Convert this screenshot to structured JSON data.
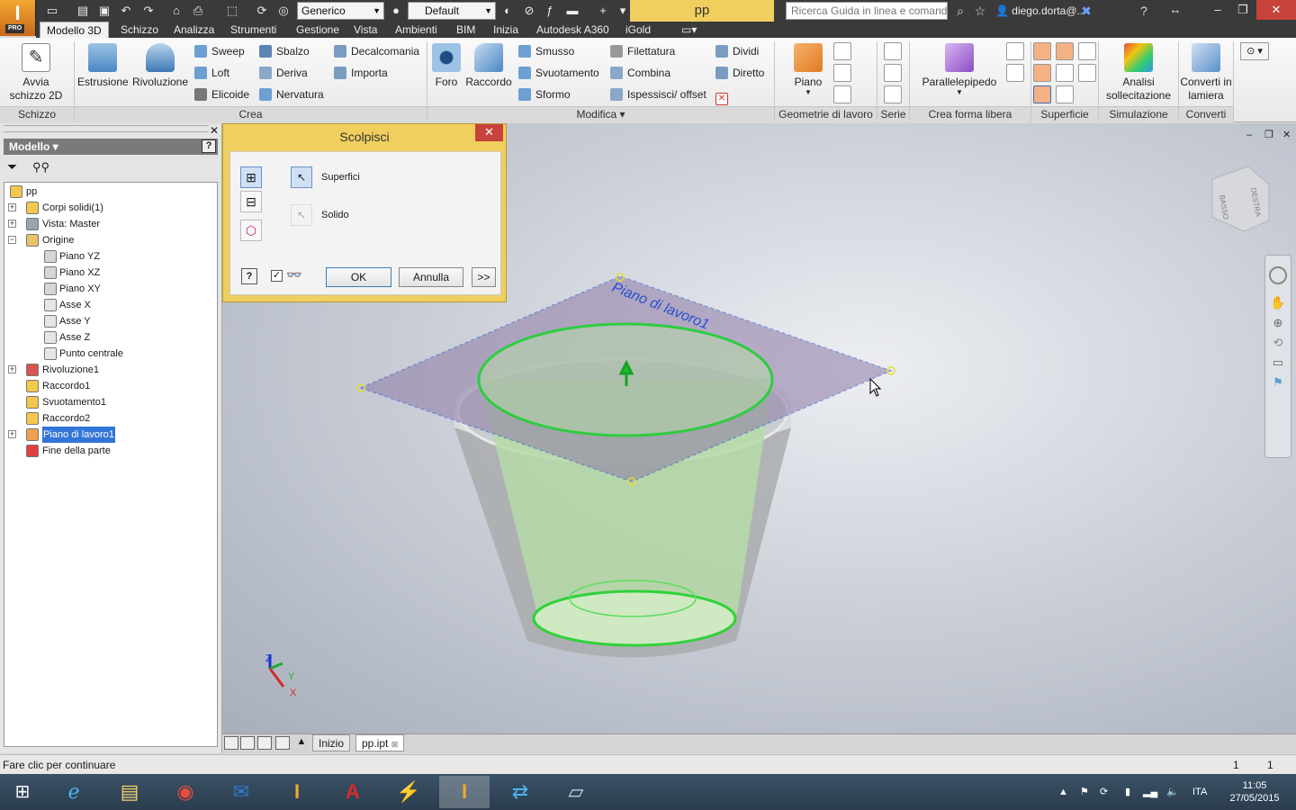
{
  "app": {
    "badge": "PRO",
    "letter": "I"
  },
  "titlebar": {
    "material_combo": "Generico",
    "appearance_combo": "Default",
    "doc_title": "pp",
    "search_placeholder": "Ricerca Guida in linea e comand",
    "user": "diego.dorta@..."
  },
  "menu_tabs": [
    "Modello 3D",
    "Schizzo",
    "Analizza",
    "Strumenti",
    "Gestione",
    "Vista",
    "Ambienti",
    "BIM",
    "Inizia",
    "Autodesk A360",
    "iGold"
  ],
  "ribbon": {
    "schizzo": {
      "avvia": "Avvia schizzo 2D",
      "footer": "Schizzo"
    },
    "crea": {
      "estrusione": "Estrusione",
      "rivoluzione": "Rivoluzione",
      "sweep": "Sweep",
      "loft": "Loft",
      "elicoide": "Elicoide",
      "sbalzo": "Sbalzo",
      "deriva": "Deriva",
      "nervatura": "Nervatura",
      "decalcomania": "Decalcomania",
      "importa": "Importa",
      "footer": "Crea"
    },
    "modifica": {
      "foro": "Foro",
      "raccordo": "Raccordo",
      "smusso": "Smusso",
      "svuotamento": "Svuotamento",
      "sformo": "Sformo",
      "filettatura": "Filettatura",
      "combina": "Combina",
      "ispessisci": "Ispessisci/ offset",
      "dividi": "Dividi",
      "diretto": "Diretto",
      "footer": "Modifica"
    },
    "geometrie": {
      "piano": "Piano",
      "footer": "Geometrie di lavoro"
    },
    "serie": {
      "footer": "Serie"
    },
    "forma_libera": {
      "parallelepipedo": "Parallelepipedo",
      "footer": "Crea forma libera"
    },
    "superficie": {
      "footer": "Superficie"
    },
    "simulazione": {
      "analisi": "Analisi sollecitazione",
      "footer": "Simulazione"
    },
    "converti": {
      "lamiera": "Converti in lamiera",
      "footer": "Converti"
    }
  },
  "browser": {
    "title": "Modello",
    "tree": [
      {
        "label": "pp",
        "level": 0,
        "expander": false,
        "icon": "part-icon",
        "color": "#f2c94c"
      },
      {
        "label": "Corpi solidi(1)",
        "level": 1,
        "expander": true,
        "icon": "solid-bodies-icon",
        "color": "#f2c94c"
      },
      {
        "label": "Vista: Master",
        "level": 1,
        "expander": true,
        "icon": "view-rep-icon",
        "color": "#9aa4b0"
      },
      {
        "label": "Origine",
        "level": 1,
        "expander": "open",
        "icon": "folder-icon",
        "color": "#e8c36a"
      },
      {
        "label": "Piano YZ",
        "level": 2,
        "expander": false,
        "icon": "plane-icon",
        "color": "#d6d6d6"
      },
      {
        "label": "Piano XZ",
        "level": 2,
        "expander": false,
        "icon": "plane-icon",
        "color": "#d6d6d6"
      },
      {
        "label": "Piano XY",
        "level": 2,
        "expander": false,
        "icon": "plane-icon",
        "color": "#d6d6d6"
      },
      {
        "label": "Asse X",
        "level": 2,
        "expander": false,
        "icon": "axis-icon",
        "color": "#e6e6e6"
      },
      {
        "label": "Asse Y",
        "level": 2,
        "expander": false,
        "icon": "axis-icon",
        "color": "#e6e6e6"
      },
      {
        "label": "Asse Z",
        "level": 2,
        "expander": false,
        "icon": "axis-icon",
        "color": "#e6e6e6"
      },
      {
        "label": "Punto centrale",
        "level": 2,
        "expander": false,
        "icon": "point-icon",
        "color": "#e6e6e6"
      },
      {
        "label": "Rivoluzione1",
        "level": 1,
        "expander": true,
        "icon": "revolve-icon",
        "color": "#d9534f"
      },
      {
        "label": "Raccordo1",
        "level": 1,
        "expander": false,
        "icon": "fillet-icon",
        "color": "#f2c94c"
      },
      {
        "label": "Svuotamento1",
        "level": 1,
        "expander": false,
        "icon": "shell-icon",
        "color": "#f2c94c"
      },
      {
        "label": "Raccordo2",
        "level": 1,
        "expander": false,
        "icon": "fillet-icon",
        "color": "#f2c94c"
      },
      {
        "label": "Piano di lavoro1",
        "level": 1,
        "expander": true,
        "icon": "workplane-icon",
        "color": "#f0a050",
        "selected": true
      },
      {
        "label": "Fine della parte",
        "level": 1,
        "expander": false,
        "icon": "end-of-part-icon",
        "color": "#e04040"
      }
    ]
  },
  "dialog": {
    "title": "Scolpisci",
    "option_surfaces": "Superfici",
    "option_solid": "Solido",
    "ok": "OK",
    "cancel": "Annulla",
    "more": ">>"
  },
  "viewport": {
    "workplane_label": "Piano di lavoro1",
    "viewcube_right": "DESTRA",
    "viewcube_bottom": "BASSO",
    "triad_z": "Z",
    "triad_y": "Y",
    "triad_x": "X"
  },
  "doc_tabs": {
    "home": "Inizio",
    "file": "pp.ipt"
  },
  "statusbar": {
    "message": "Fare clic per continuare",
    "count1": "1",
    "count2": "1"
  },
  "taskbar": {
    "lang": "ITA",
    "time": "11:05",
    "date": "27/05/2015"
  },
  "colors": {
    "titlebar": "#3a3a3a",
    "accent_orange": "#f2a830",
    "dialog": "#f1cf5f",
    "selection": "#3375d6",
    "edge_green": "#2ecc40"
  }
}
